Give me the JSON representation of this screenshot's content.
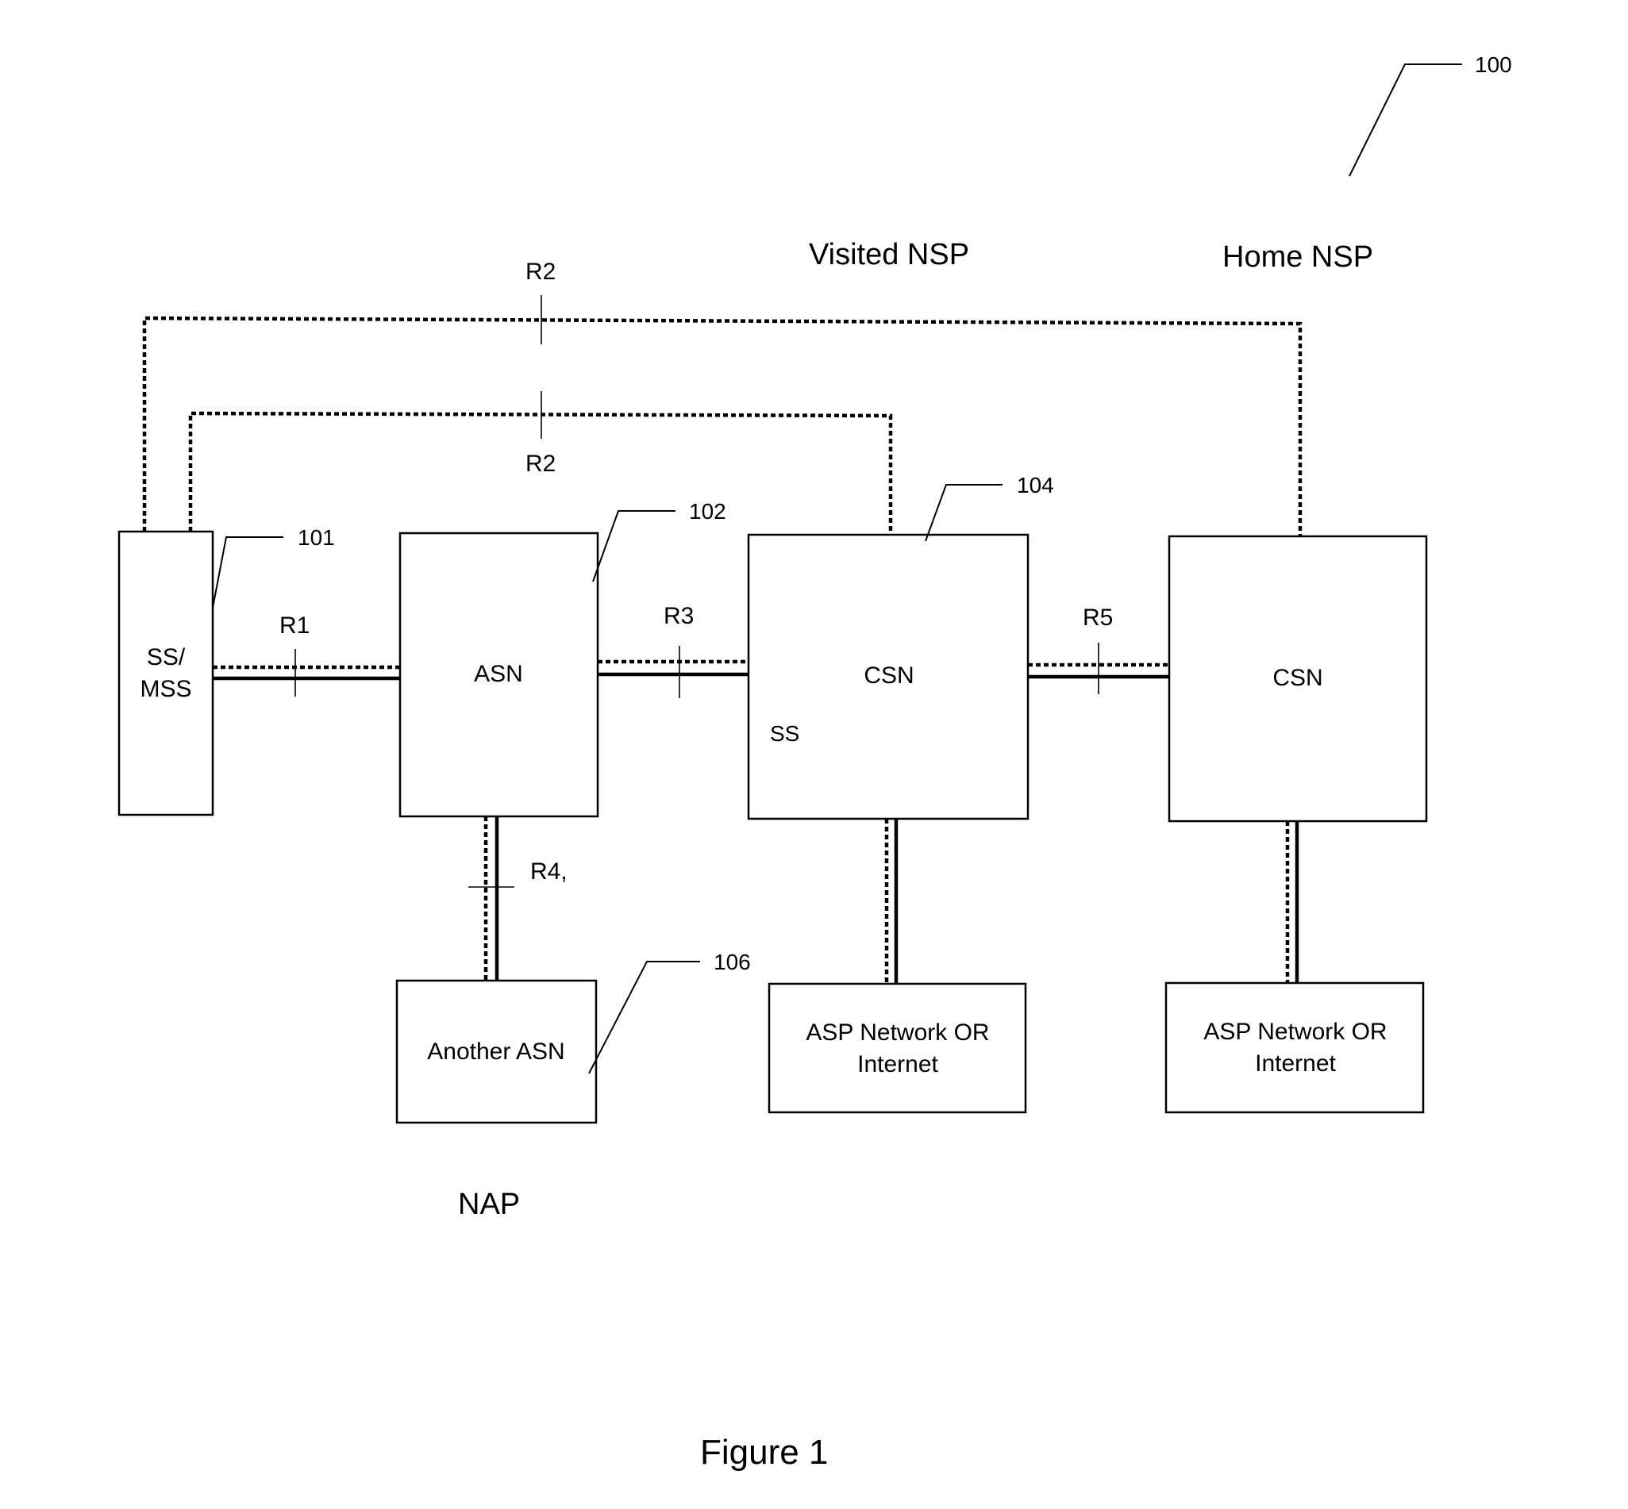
{
  "figure": {
    "caption": "Figure 1",
    "reference": "100",
    "regions": {
      "visited_nsp": "Visited NSP",
      "home_nsp": "Home NSP",
      "nap": "NAP"
    }
  },
  "nodes": {
    "ss_mss": {
      "line1": "SS/",
      "line2": "MSS",
      "ref": "101"
    },
    "asn": {
      "label": "ASN",
      "ref": "102"
    },
    "csn_visited": {
      "label": "CSN",
      "sublabel": "SS",
      "ref": "104"
    },
    "csn_home": {
      "label": "CSN"
    },
    "another_asn": {
      "label": "Another ASN",
      "ref": "106"
    },
    "asp_visited": {
      "line1": "ASP Network OR",
      "line2": "Internet"
    },
    "asp_home": {
      "line1": "ASP Network  OR",
      "line2": "Internet"
    }
  },
  "reference_points": {
    "r1": "R1",
    "r2_outer": "R2",
    "r2_inner": "R2",
    "r3": "R3",
    "r4": "R4,",
    "r5": "R5"
  }
}
